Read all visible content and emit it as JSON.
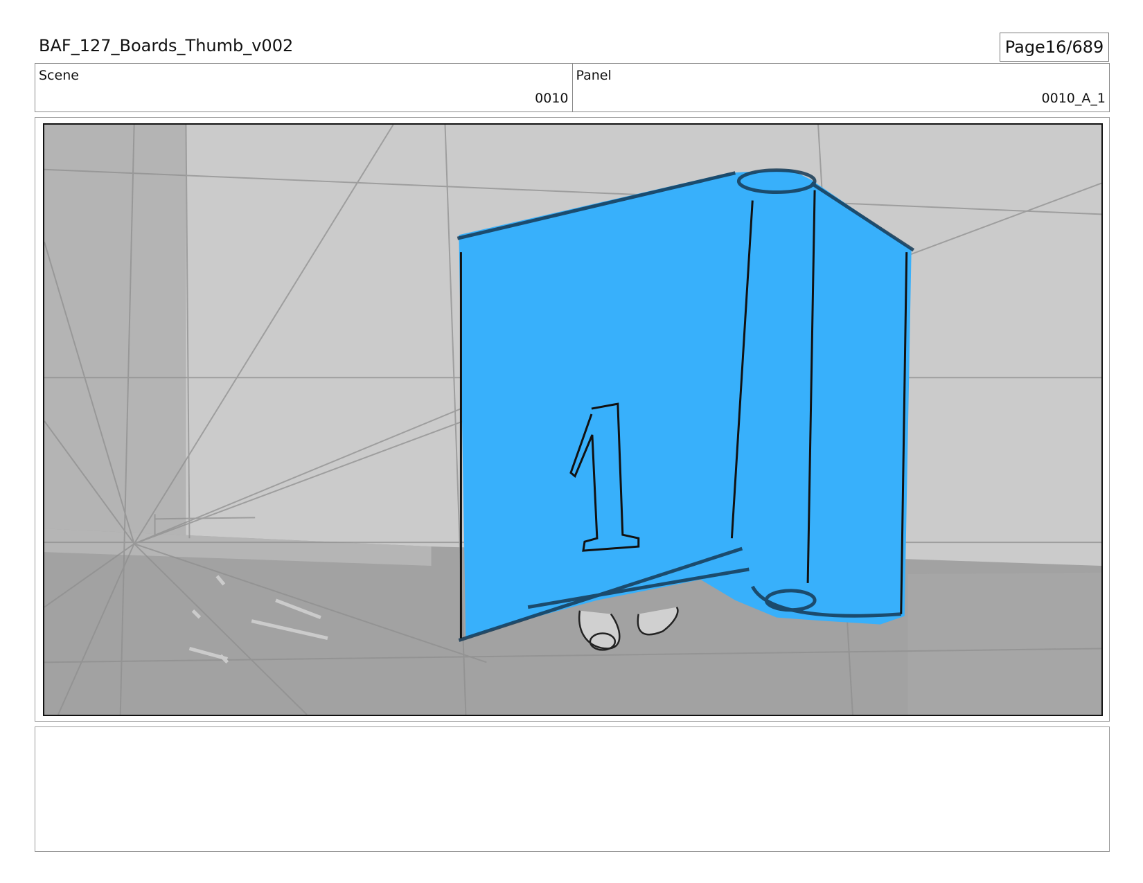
{
  "header": {
    "title": "BAF_127_Boards_Thumb_v002",
    "page_label": "Page",
    "page_number": "16/689"
  },
  "info": {
    "scene_label": "Scene",
    "scene_value": "0010",
    "panel_label": "Panel",
    "panel_value": "0010_A_1"
  },
  "panel": {
    "block_number": "1",
    "colors": {
      "block_blue": "#38b0fb",
      "wall": "#cbcbcb",
      "floor": "#a3a3a3",
      "sketch_line": "#111111"
    }
  },
  "notes": {
    "text": ""
  }
}
